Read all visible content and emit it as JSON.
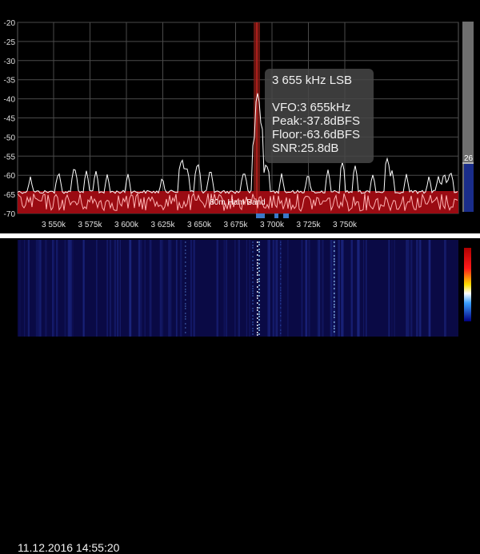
{
  "spectrum": {
    "y_ticks": [
      "-20",
      "-25",
      "-30",
      "-35",
      "-40",
      "-45",
      "-50",
      "-55",
      "-60",
      "-65",
      "-70"
    ],
    "x_ticks": [
      "3 550k",
      "3 575k",
      "3 600k",
      "3 625k",
      "3 650k",
      "3 675k",
      "3 700k",
      "3 725k",
      "3 750k"
    ],
    "band_label": "80m Ham Band",
    "level_value": "26",
    "colors": {
      "band": "#9a0b12",
      "trace_above": "#ffffff",
      "trace_in_band": "#ffb3b3",
      "passband": "#3a78c8"
    }
  },
  "tooltip": {
    "title": "3 655 kHz LSB",
    "vfo": "VFO:3 655kHz",
    "peak": "Peak:-37.8dBFS",
    "floor": "Floor:-63.6dBFS",
    "snr": "SNR:25.8dB"
  },
  "waterfall": {
    "timestamp": "11.12.2016 14:55:20",
    "colors": {
      "background": "#0a0a45",
      "signal": "#ffffff"
    }
  }
}
